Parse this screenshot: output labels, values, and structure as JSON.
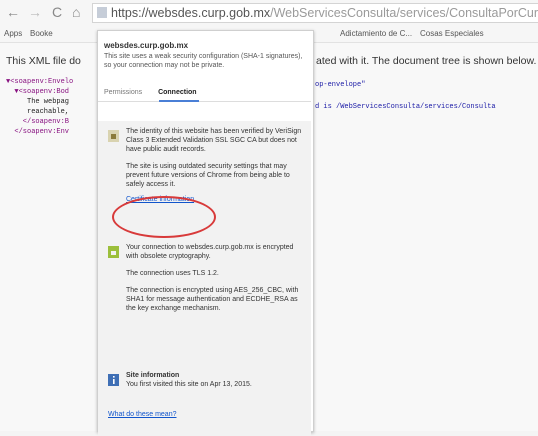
{
  "browser": {
    "url_host": "https://websdes.curp.gob.mx",
    "url_path": "/WebServicesConsulta/services/ConsultaPorCurpServic",
    "bookmarks": [
      "Apps",
      "Booke",
      "Adictamiento de C...",
      "Cosas Especiales"
    ]
  },
  "page": {
    "xml_note_left": "This XML file do",
    "xml_note_right": "ated with it. The document tree is shown below.",
    "tree_lines": [
      "▼<soapenv:Envelo",
      "  ▼<soapenv:Bod",
      "     The webpag",
      "     reachable,",
      "    </soapenv:B",
      "  </soapenv:Env"
    ],
    "code_right_1": "op-envelope\"",
    "code_right_2": "d is /WebServicesConsulta/services/Consulta"
  },
  "popup": {
    "host": "websdes.curp.gob.mx",
    "warning": "This site uses a weak security configuration (SHA-1 signatures), so your connection may not be private.",
    "tab_permissions": "Permissions",
    "tab_connection": "Connection",
    "identity_text": "The identity of this website has been verified by VeriSign Class 3 Extended Validation SSL SGC CA but does not have public audit records.",
    "outdated_text": "The site is using outdated security settings that may prevent future versions of Chrome from being able to safely access it.",
    "cert_link": "Certificate information",
    "encrypted_text": "Your connection to websdes.curp.gob.mx is encrypted with obsolete cryptography.",
    "tls_text": "The connection uses TLS 1.2.",
    "cipher_text": "The connection is encrypted using AES_256_CBC, with SHA1 for message authentication and ECDHE_RSA as the key exchange mechanism.",
    "site_info_title": "Site information",
    "site_info_text": "You first visited this site on Apr 13, 2015.",
    "what_link": "What do these mean?"
  },
  "colors": {
    "accent_blue": "#4a7fd6",
    "highlight_red": "#d83a3a",
    "lock_gray": "#c6cdd8"
  },
  "icons": [
    "back-arrow-icon",
    "forward-arrow-icon",
    "reload-icon",
    "home-icon",
    "lock-icon",
    "certificate-lock-icon",
    "connection-lock-icon",
    "info-icon"
  ]
}
